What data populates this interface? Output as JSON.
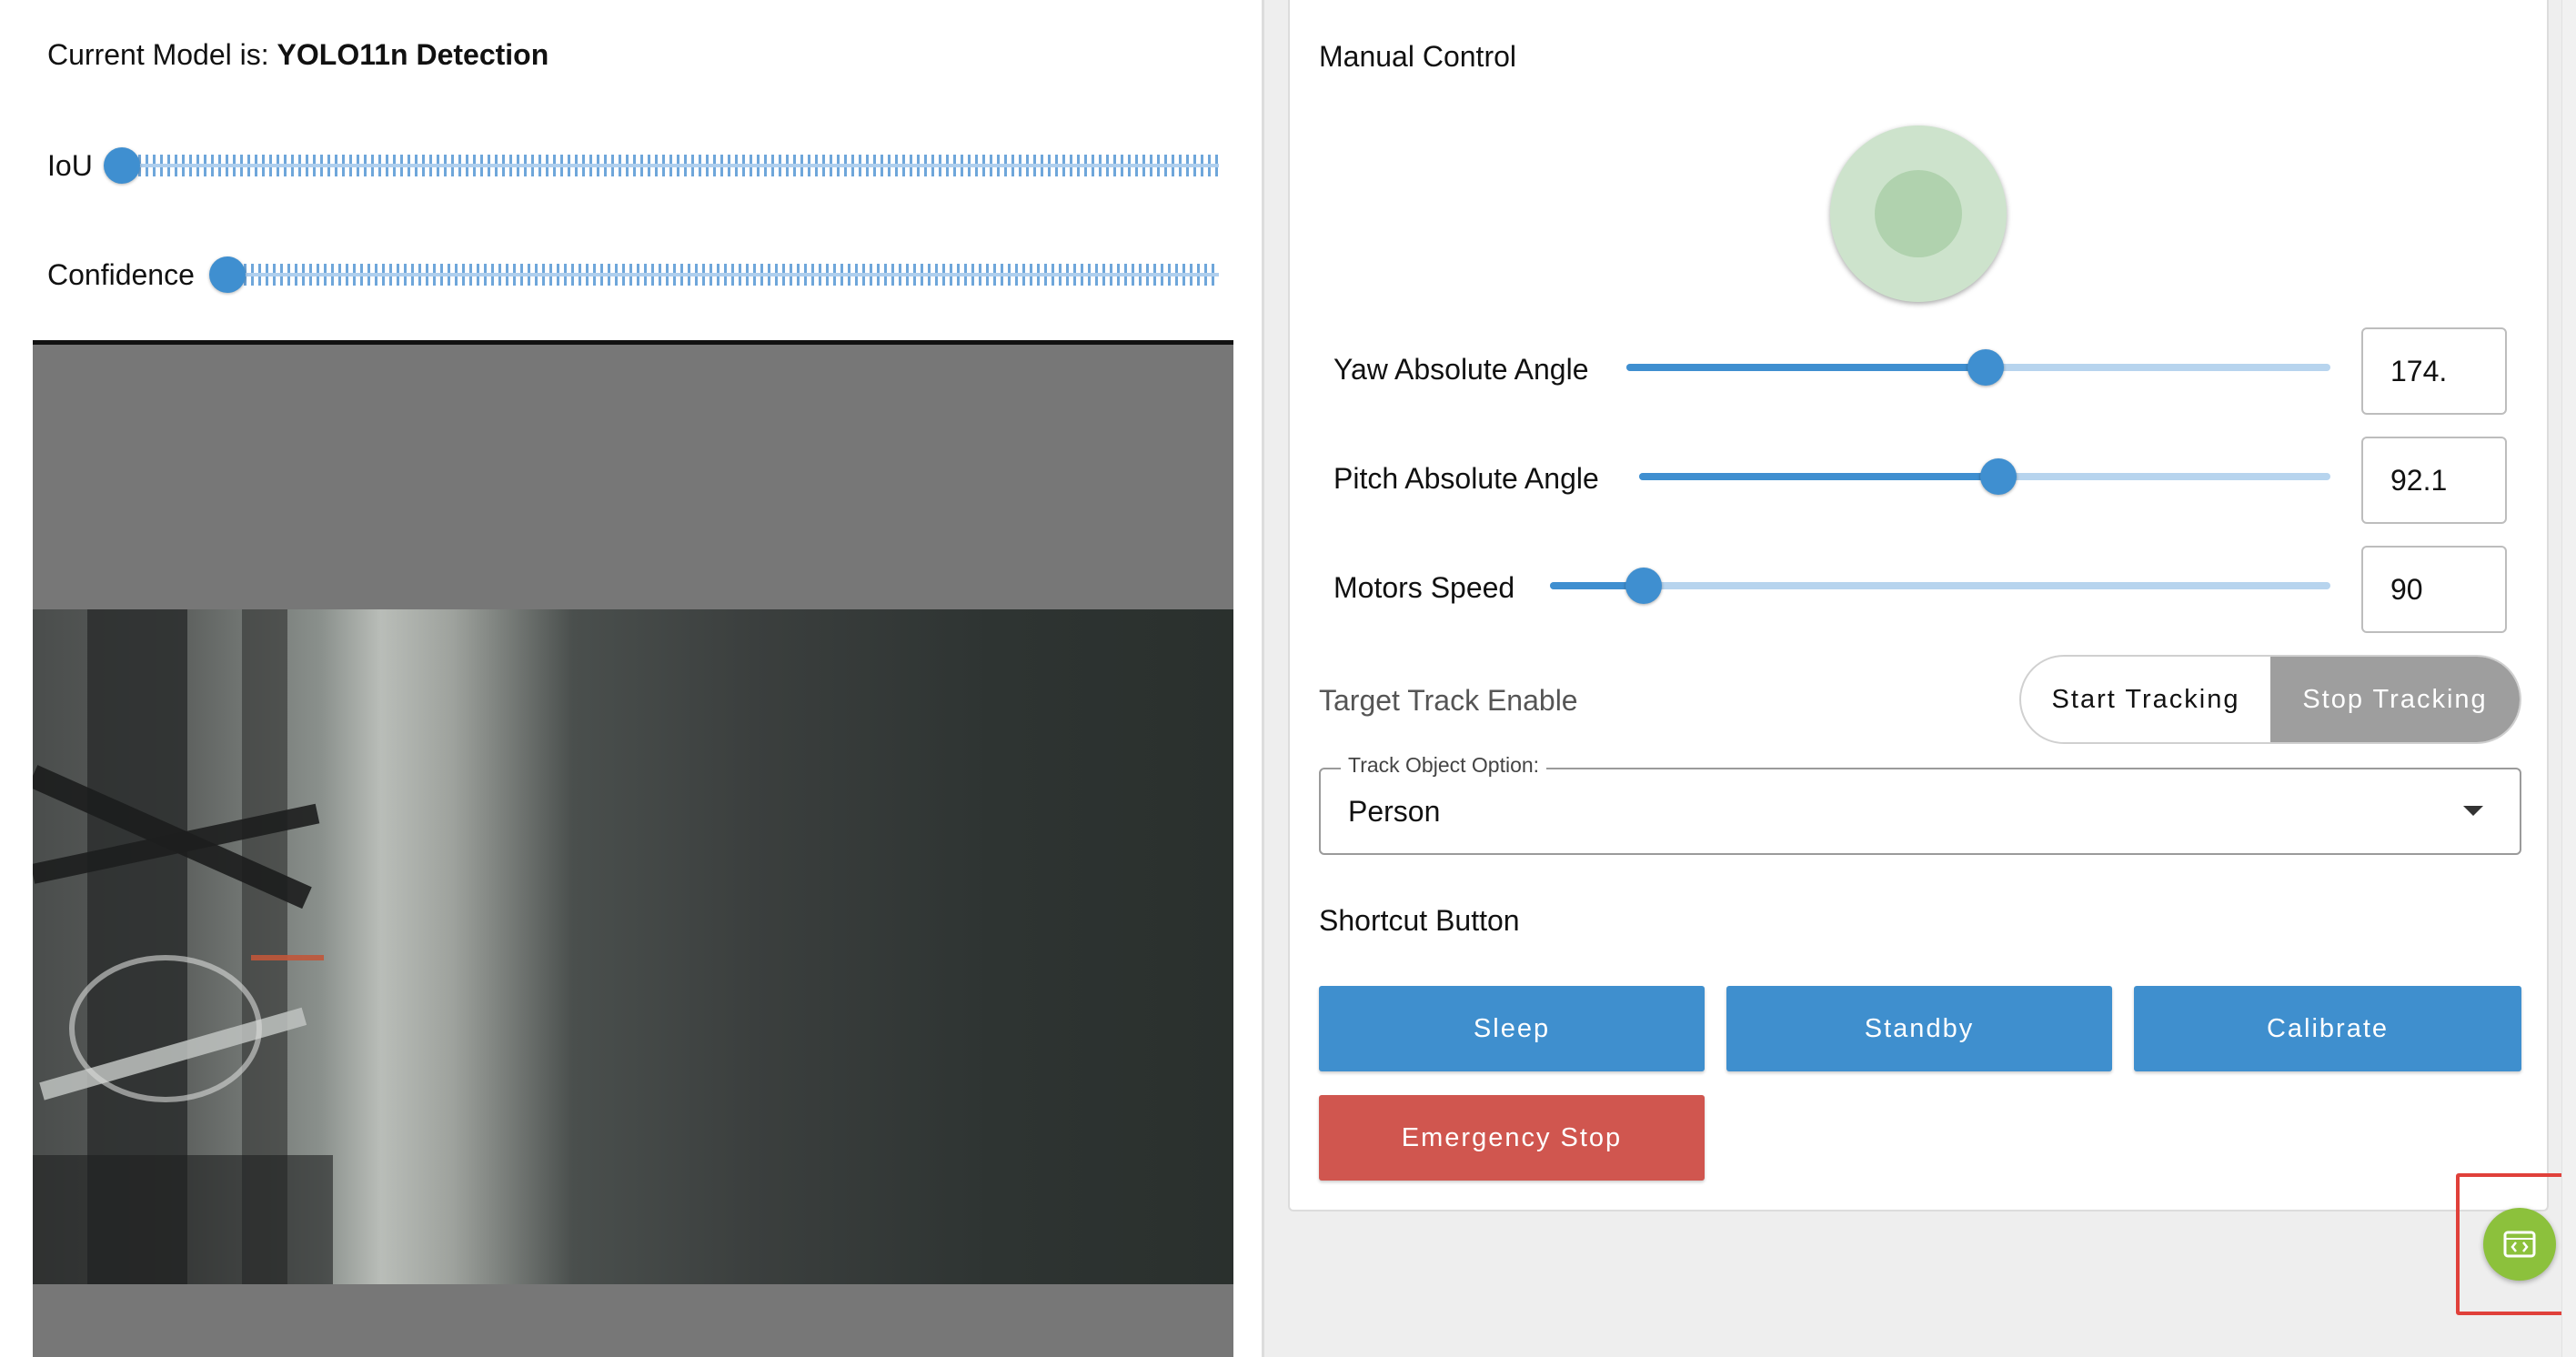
{
  "model": {
    "prefix": "Current Model is: ",
    "name": "YOLO11n Detection"
  },
  "detection_sliders": {
    "iou_label": "IoU",
    "iou_level": 0,
    "confidence_label": "Confidence",
    "confidence_level": 0
  },
  "manual_control": {
    "title": "Manual Control",
    "yaw": {
      "label": "Yaw Absolute Angle",
      "value": "174.",
      "level": 0.51
    },
    "pitch": {
      "label": "Pitch Absolute Angle",
      "value": "92.1",
      "level": 0.52
    },
    "speed": {
      "label": "Motors Speed",
      "value": "90",
      "level": 0.12
    }
  },
  "tracking": {
    "label": "Target Track Enable",
    "start_label": "Start Tracking",
    "stop_label": "Stop Tracking",
    "active": "Stop Tracking"
  },
  "track_object": {
    "legend": "Track Object Option:",
    "value": "Person"
  },
  "shortcuts": {
    "title": "Shortcut Button",
    "sleep": "Sleep",
    "standby": "Standby",
    "calibrate": "Calibrate",
    "emergency_stop": "Emergency Stop"
  },
  "colors": {
    "primary": "#3f8fce",
    "danger": "#d0564f",
    "fab": "#8cc13c",
    "joystick": "#cde3cc"
  },
  "icons": {
    "fab_icon": "code-window-icon"
  }
}
